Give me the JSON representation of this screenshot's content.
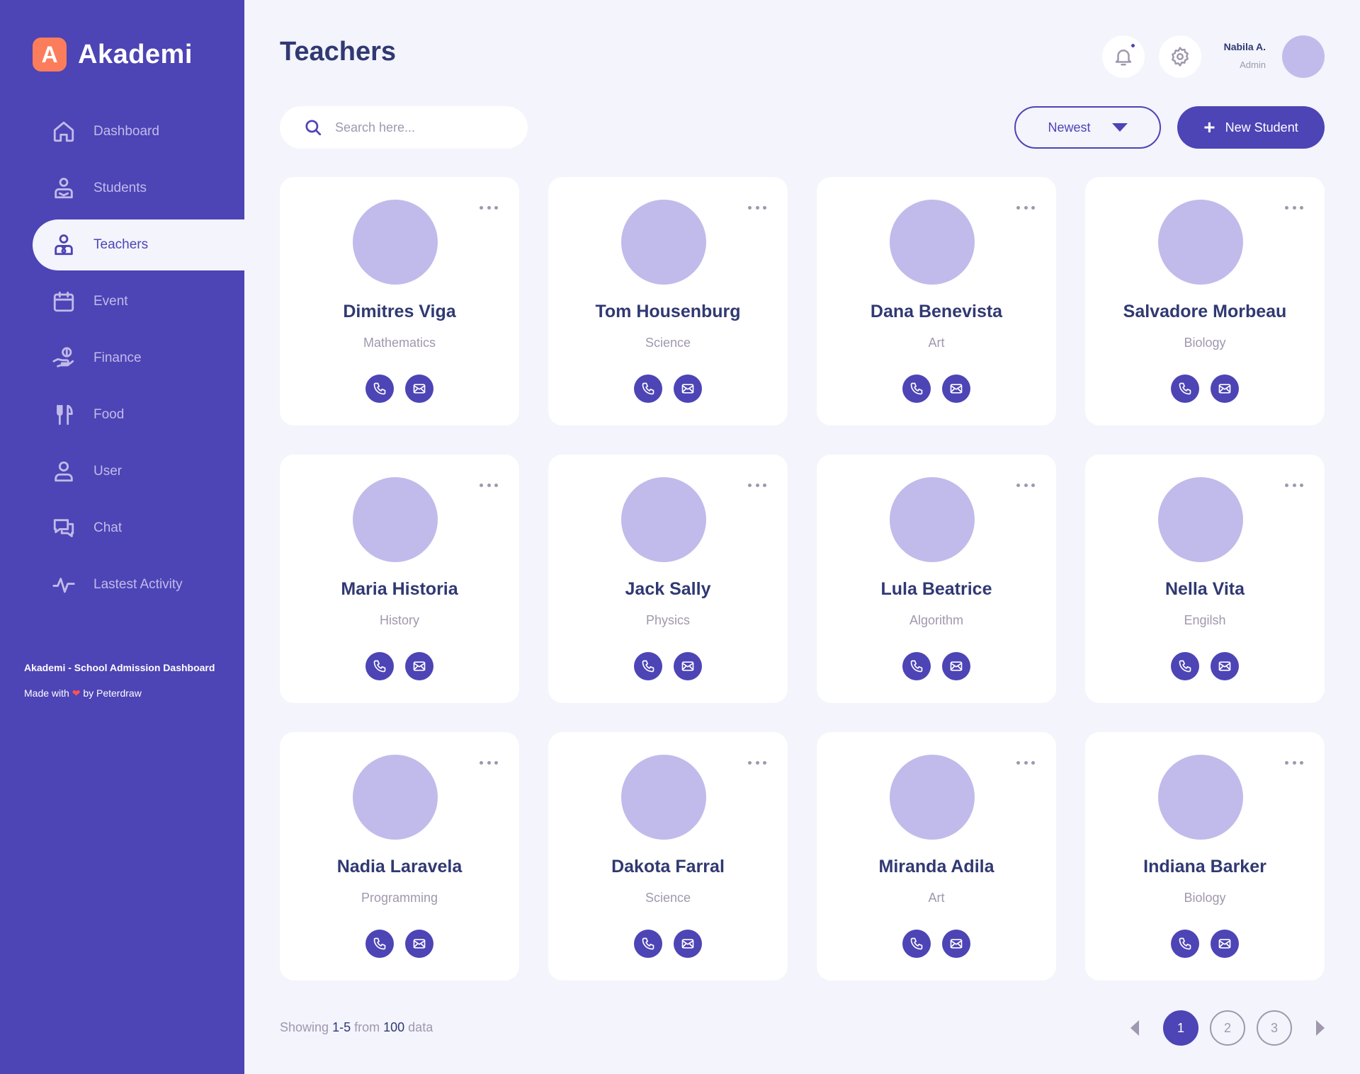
{
  "app": {
    "logo_letter": "A",
    "name": "Akademi"
  },
  "nav": [
    {
      "label": "Dashboard",
      "icon": "home-icon"
    },
    {
      "label": "Students",
      "icon": "student-icon"
    },
    {
      "label": "Teachers",
      "icon": "teacher-icon",
      "active": true
    },
    {
      "label": "Event",
      "icon": "calendar-icon"
    },
    {
      "label": "Finance",
      "icon": "finance-icon"
    },
    {
      "label": "Food",
      "icon": "food-icon"
    },
    {
      "label": "User",
      "icon": "user-icon"
    },
    {
      "label": "Chat",
      "icon": "chat-icon"
    },
    {
      "label": "Lastest Activity",
      "icon": "activity-icon"
    }
  ],
  "footer": {
    "title": "Akademi - School Admission Dashboard",
    "made_prefix": "Made with",
    "heart": "❤",
    "made_suffix": "by Peterdraw"
  },
  "header": {
    "title": "Teachers",
    "user_name": "Nabila A.",
    "user_role": "Admin"
  },
  "toolbar": {
    "search_placeholder": "Search here...",
    "sort_label": "Newest",
    "new_button_label": "New Student"
  },
  "teachers": [
    {
      "name": "Dimitres Viga",
      "subject": "Mathematics"
    },
    {
      "name": "Tom Housenburg",
      "subject": "Science"
    },
    {
      "name": "Dana Benevista",
      "subject": "Art"
    },
    {
      "name": "Salvadore Morbeau",
      "subject": "Biology"
    },
    {
      "name": "Maria Historia",
      "subject": "History"
    },
    {
      "name": "Jack Sally",
      "subject": "Physics"
    },
    {
      "name": "Lula Beatrice",
      "subject": "Algorithm"
    },
    {
      "name": "Nella Vita",
      "subject": "Engilsh"
    },
    {
      "name": "Nadia Laravela",
      "subject": "Programming"
    },
    {
      "name": "Dakota Farral",
      "subject": "Science"
    },
    {
      "name": "Miranda Adila",
      "subject": "Art"
    },
    {
      "name": "Indiana Barker",
      "subject": "Biology"
    }
  ],
  "pagination": {
    "showing_prefix": "Showing",
    "range": "1-5",
    "from_word": "from",
    "total": "100",
    "suffix": "data",
    "pages": [
      "1",
      "2",
      "3"
    ],
    "current_page": 1
  },
  "colors": {
    "primary": "#4d44b5",
    "accent": "#fb7d5b",
    "background": "#f3f4fc",
    "text_dark": "#303972",
    "text_muted": "#a098ae",
    "avatar_placeholder": "#c1bbeb"
  }
}
